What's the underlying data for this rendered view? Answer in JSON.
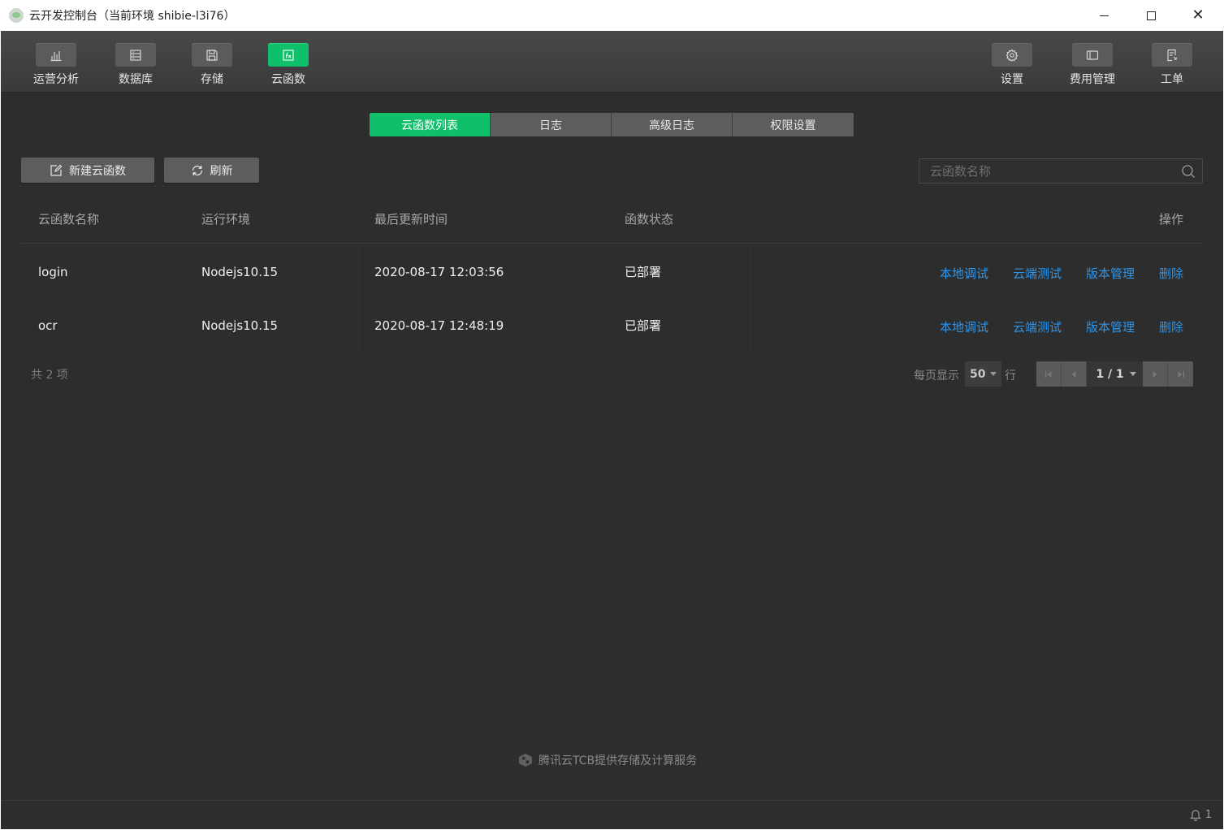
{
  "window": {
    "title": "云开发控制台（当前环境 shibie-l3i76）"
  },
  "toolbar": {
    "left": [
      {
        "label": "运营分析",
        "icon": "bar-chart-icon",
        "active": false
      },
      {
        "label": "数据库",
        "icon": "database-icon",
        "active": false
      },
      {
        "label": "存储",
        "icon": "storage-icon",
        "active": false
      },
      {
        "label": "云函数",
        "icon": "function-icon",
        "active": true
      }
    ],
    "right": [
      {
        "label": "设置",
        "icon": "gear-icon"
      },
      {
        "label": "费用管理",
        "icon": "billing-icon"
      },
      {
        "label": "工单",
        "icon": "ticket-icon"
      }
    ]
  },
  "tabs": [
    "云函数列表",
    "日志",
    "高级日志",
    "权限设置"
  ],
  "active_tab": "云函数列表",
  "actions": {
    "new_label": "新建云函数",
    "refresh_label": "刷新"
  },
  "search": {
    "placeholder": "云函数名称",
    "value": ""
  },
  "table": {
    "headers": [
      "云函数名称",
      "运行环境",
      "最后更新时间",
      "函数状态",
      "操作"
    ],
    "rows": [
      {
        "name": "login",
        "runtime": "Nodejs10.15",
        "updated": "2020-08-17 12:03:56",
        "status": "已部署"
      },
      {
        "name": "ocr",
        "runtime": "Nodejs10.15",
        "updated": "2020-08-17 12:48:19",
        "status": "已部署"
      }
    ],
    "row_actions": [
      "本地调试",
      "云端测试",
      "版本管理",
      "删除"
    ]
  },
  "pagination": {
    "total_text": "共 2 项",
    "page_size_label": "每页显示",
    "page_size": "50",
    "page_size_unit": "行",
    "current": "1 / 1"
  },
  "footer": {
    "powered_by": "腾讯云TCB提供存储及计算服务",
    "notification_count": "1"
  },
  "colors": {
    "accent": "#0fbf69",
    "link": "#2f95e8",
    "background": "#2d2d2d"
  }
}
